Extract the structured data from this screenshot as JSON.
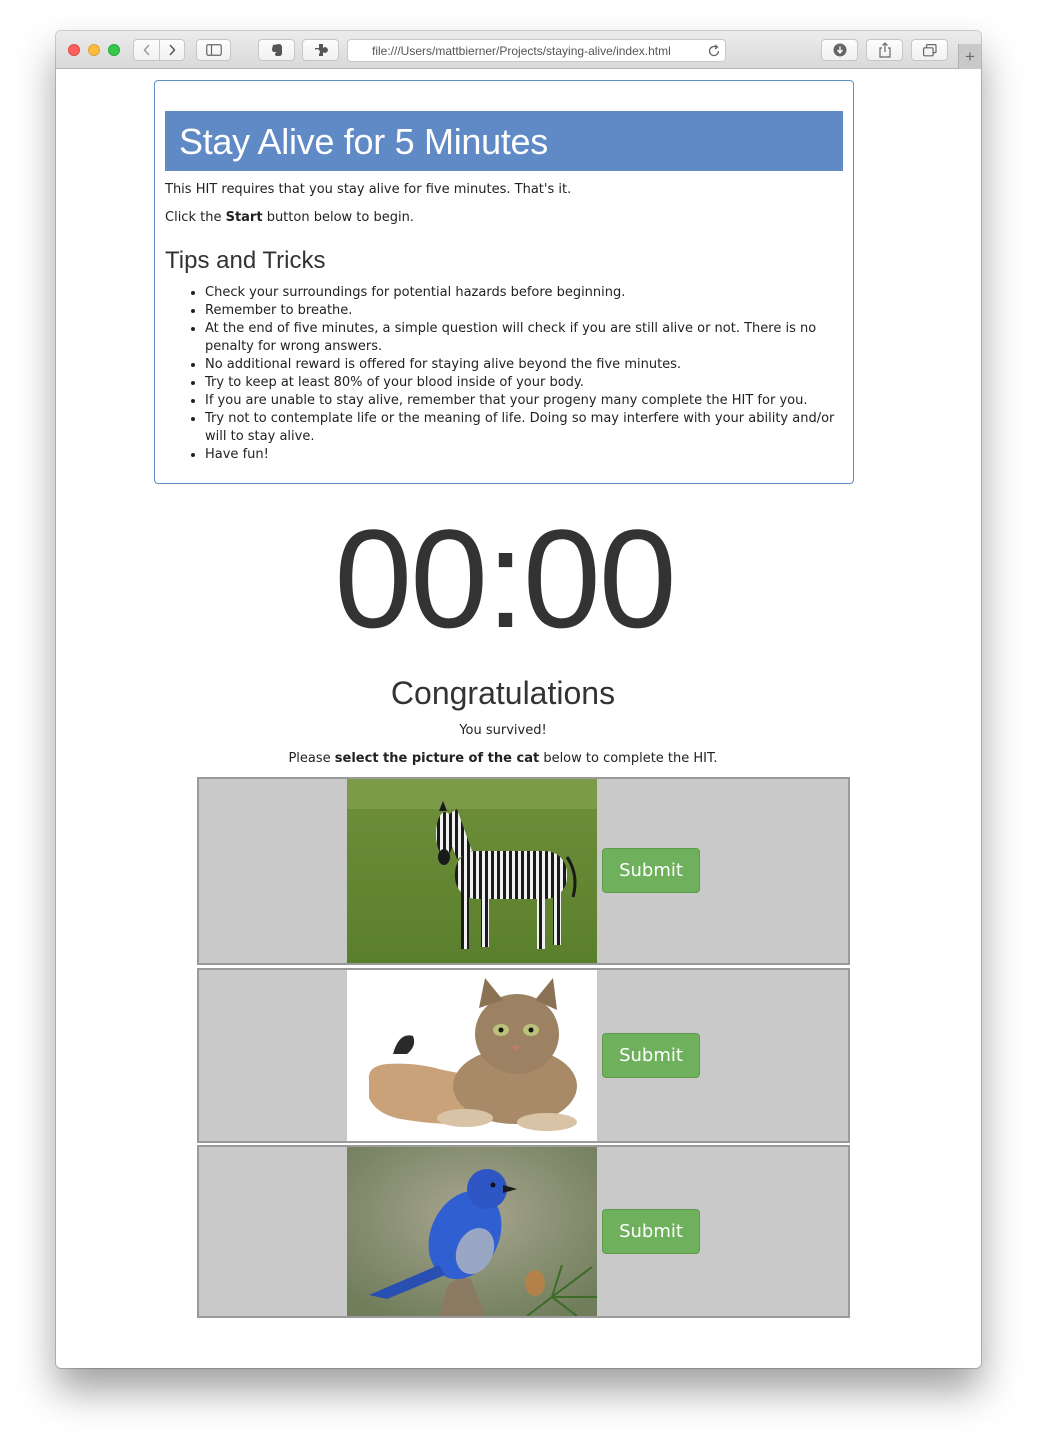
{
  "browser": {
    "url": "file:///Users/mattbierner/Projects/staying-alive/index.html"
  },
  "page": {
    "title": "Stay Alive for 5 Minutes",
    "intro": "This HIT requires that you stay alive for five minutes. That's it.",
    "start_prefix": "Click the ",
    "start_bold": "Start",
    "start_suffix": " button below to begin.",
    "tips_title": "Tips and Tricks",
    "tips": [
      "Check your surroundings for potential hazards before beginning.",
      "Remember to breathe.",
      "At the end of five minutes, a simple question will check if you are still alive or not. There is no penalty for wrong answers.",
      "No additional reward is offered for staying alive beyond the five minutes.",
      "Try to keep at least 80% of your blood inside of your body.",
      "If you are unable to stay alive, remember that your progeny many complete the HIT for you.",
      "Try not to contemplate life or the meaning of life. Doing so may interfere with your ability and/or will to stay alive.",
      "Have fun!"
    ],
    "timer": "00:00",
    "congrats_title": "Congratulations",
    "survived": "You survived!",
    "instr_prefix": "Please ",
    "instr_bold": "select the picture of the cat",
    "instr_suffix": " below to complete the HIT.",
    "choices": [
      {
        "animal": "zebra",
        "submit_label": "Submit"
      },
      {
        "animal": "cat",
        "submit_label": "Submit"
      },
      {
        "animal": "bluebird",
        "submit_label": "Submit"
      }
    ],
    "colors": {
      "banner": "#5f8ac6",
      "submit": "#6fb05c",
      "choice_row": "#c9c9c9"
    }
  }
}
